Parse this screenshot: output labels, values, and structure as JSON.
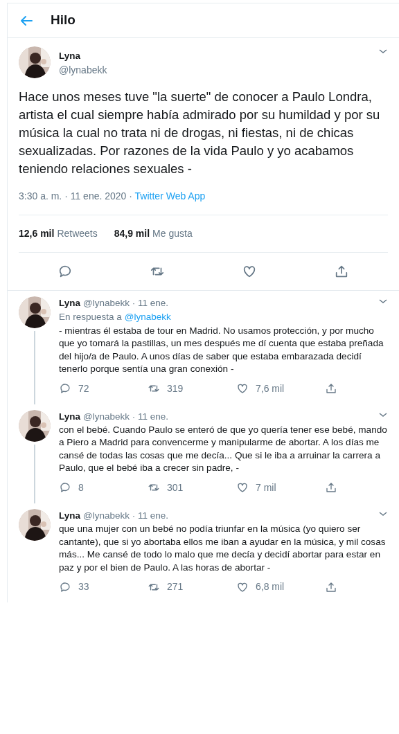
{
  "header": {
    "title": "Hilo"
  },
  "main_tweet": {
    "name": "Lyna",
    "handle": "@lynabekk",
    "text": "Hace unos meses tuve \"la suerte\" de conocer a Paulo Londra, artista el cual siempre había admirado por su humildad y por su música la cual no trata ni de drogas, ni fiestas, ni de chicas sexualizadas. Por razones de la vida Paulo y yo acabamos teniendo relaciones sexuales -",
    "time": "3:30 a. m. · 11 ene. 2020 · ",
    "source": "Twitter Web App",
    "stats": [
      {
        "count": "12,6 mil",
        "label": "Retweets"
      },
      {
        "count": "84,9 mil",
        "label": "Me gusta"
      }
    ]
  },
  "replies": [
    {
      "name": "Lyna",
      "handle": "@lynabekk · 11 ene.",
      "reply_prefix": "En respuesta a",
      "reply_to": "@lynabekk",
      "text": "- mientras él estaba de tour en Madrid. No usamos protección, y por mucho que yo tomará la pastillas, un mes después me dí cuenta que estaba preñada del hijo/a de Paulo. A unos días de saber que estaba embarazada decidí tenerlo porque sentía una gran conexión -",
      "replies": "72",
      "retweets": "319",
      "likes": "7,6 mil"
    },
    {
      "name": "Lyna",
      "handle": "@lynabekk · 11 ene.",
      "text": "con el bebé. Cuando Paulo se enteró de que yo quería tener ese bebé, mando a Piero a Madrid para convencerme y manipularme de abortar. A los días me cansé de todas las cosas que me decía... Que si le iba a arruinar la carrera a Paulo, que el bebé iba a crecer sin padre, -",
      "replies": "8",
      "retweets": "301",
      "likes": "7 mil"
    },
    {
      "name": "Lyna",
      "handle": "@lynabekk · 11 ene.",
      "text": "que una mujer con un bebé no podía triunfar en la música (yo quiero ser cantante), que si yo abortaba ellos me iban a ayudar en la música, y mil cosas más... Me cansé de todo lo malo que me decía y decidí abortar para estar en paz y por el bien de Paulo. A las horas de abortar -",
      "replies": "33",
      "retweets": "271",
      "likes": "6,8 mil"
    }
  ]
}
